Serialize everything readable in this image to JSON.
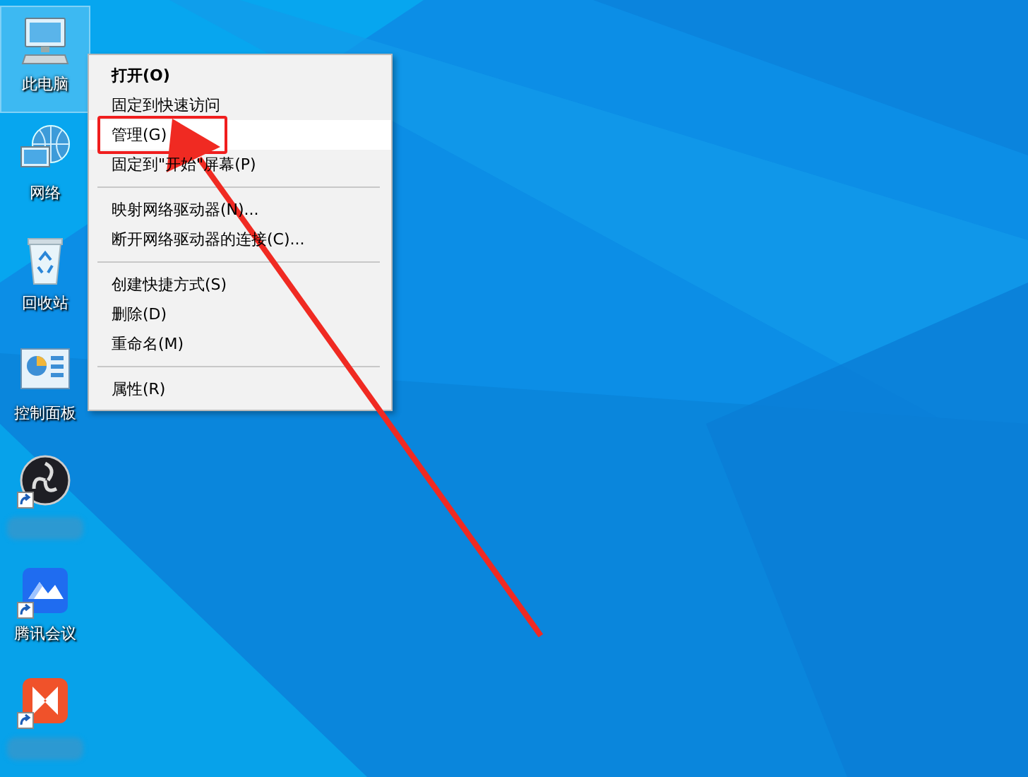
{
  "desktop_icons": [
    {
      "kind": "computer",
      "label": "此电脑",
      "selected": true
    },
    {
      "kind": "network",
      "label": "网络",
      "selected": false
    },
    {
      "kind": "recycle-bin",
      "label": "回收站",
      "selected": false
    },
    {
      "kind": "control-panel",
      "label": "控制面板",
      "selected": false
    },
    {
      "kind": "obs",
      "label_hidden": true,
      "shortcut": true,
      "selected": false
    },
    {
      "kind": "meeting",
      "label": "腾讯会议",
      "shortcut": true,
      "selected": false
    },
    {
      "kind": "video",
      "label_hidden": true,
      "shortcut": true,
      "selected": false
    }
  ],
  "context_menu": {
    "items": [
      {
        "kind": "item",
        "label": "打开(O)",
        "default": true,
        "selected": false
      },
      {
        "kind": "item",
        "label": "固定到快速访问",
        "default": false,
        "selected": false
      },
      {
        "kind": "item",
        "label": "管理(G)",
        "default": false,
        "selected": true,
        "outlined": true
      },
      {
        "kind": "item",
        "label": "固定到\"开始\"屏幕(P)",
        "default": false,
        "selected": false
      },
      {
        "kind": "separator"
      },
      {
        "kind": "item",
        "label": "映射网络驱动器(N)...",
        "default": false,
        "selected": false
      },
      {
        "kind": "item",
        "label": "断开网络驱动器的连接(C)...",
        "default": false,
        "selected": false
      },
      {
        "kind": "separator"
      },
      {
        "kind": "item",
        "label": "创建快捷方式(S)",
        "default": false,
        "selected": false
      },
      {
        "kind": "item",
        "label": "删除(D)",
        "default": false,
        "selected": false
      },
      {
        "kind": "item",
        "label": "重命名(M)",
        "default": false,
        "selected": false
      },
      {
        "kind": "separator"
      },
      {
        "kind": "item",
        "label": "属性(R)",
        "default": false,
        "selected": false
      }
    ]
  },
  "annotations": [
    {
      "kind": "arrow"
    }
  ]
}
